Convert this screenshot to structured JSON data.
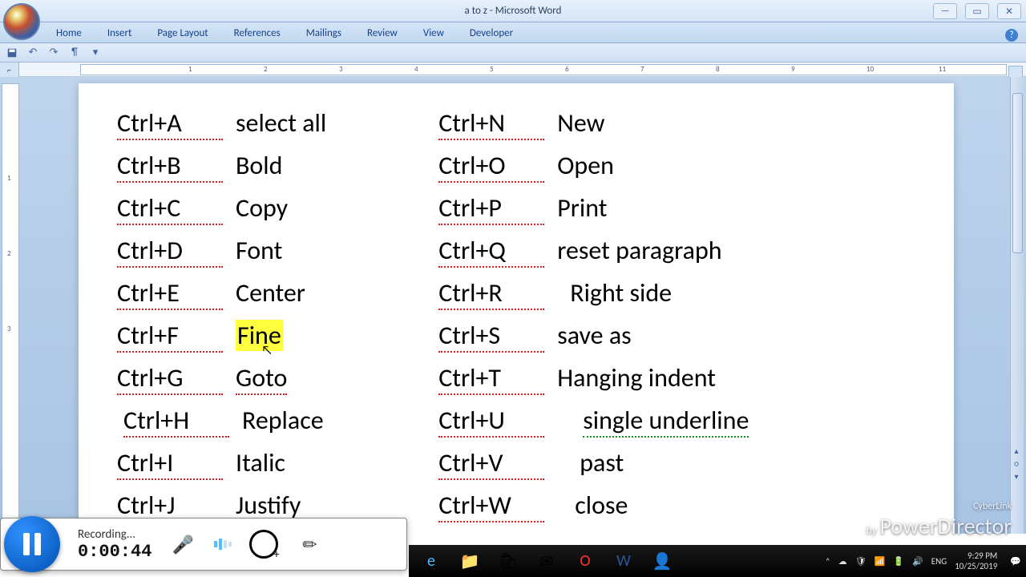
{
  "window": {
    "title": "a to z - Microsoft Word"
  },
  "ribbon": {
    "tabs": [
      "Home",
      "Insert",
      "Page Layout",
      "References",
      "Mailings",
      "Review",
      "View",
      "Developer"
    ]
  },
  "ruler": {
    "ticks": [
      "1",
      "2",
      "3",
      "4",
      "5",
      "6",
      "7",
      "8",
      "9",
      "10",
      "11"
    ]
  },
  "vruler": {
    "ticks": [
      "1",
      "2",
      "3"
    ]
  },
  "shortcuts": {
    "left": [
      {
        "key": "Ctrl+A",
        "desc": "select all"
      },
      {
        "key": "Ctrl+B",
        "desc": "Bold"
      },
      {
        "key": "Ctrl+C",
        "desc": "Copy"
      },
      {
        "key": "Ctrl+D",
        "desc": "Font"
      },
      {
        "key": "Ctrl+E",
        "desc": "Center"
      },
      {
        "key": "Ctrl+F",
        "desc": "Fine",
        "highlight": true
      },
      {
        "key": "Ctrl+G",
        "desc": "Goto",
        "underline": true
      },
      {
        "key": "Ctrl+H",
        "desc": "Replace"
      },
      {
        "key": "Ctrl+I",
        "desc": "Italic"
      },
      {
        "key": "Ctrl+J",
        "desc": "Justify"
      }
    ],
    "right": [
      {
        "key": "Ctrl+N",
        "desc": "New"
      },
      {
        "key": "Ctrl+O",
        "desc": "Open"
      },
      {
        "key": "Ctrl+P",
        "desc": "Print"
      },
      {
        "key": "Ctrl+Q",
        "desc": "reset paragraph"
      },
      {
        "key": "Ctrl+R",
        "desc": "Right side"
      },
      {
        "key": "Ctrl+S",
        "desc": "save as"
      },
      {
        "key": "Ctrl+T",
        "desc": "Hanging indent"
      },
      {
        "key": "Ctrl+U",
        "desc": "single  underline",
        "green": true
      },
      {
        "key": "Ctrl+V",
        "desc": "past"
      },
      {
        "key": "Ctrl+W",
        "desc": "close"
      }
    ]
  },
  "recorder": {
    "status": "Recording...",
    "elapsed": "0:00:44"
  },
  "tray": {
    "lang": "ENG",
    "time": "9:29 PM",
    "date": "10/25/2019"
  },
  "watermark": {
    "by": "by",
    "brand": "PowerDirector",
    "cl": "CyberLink"
  }
}
